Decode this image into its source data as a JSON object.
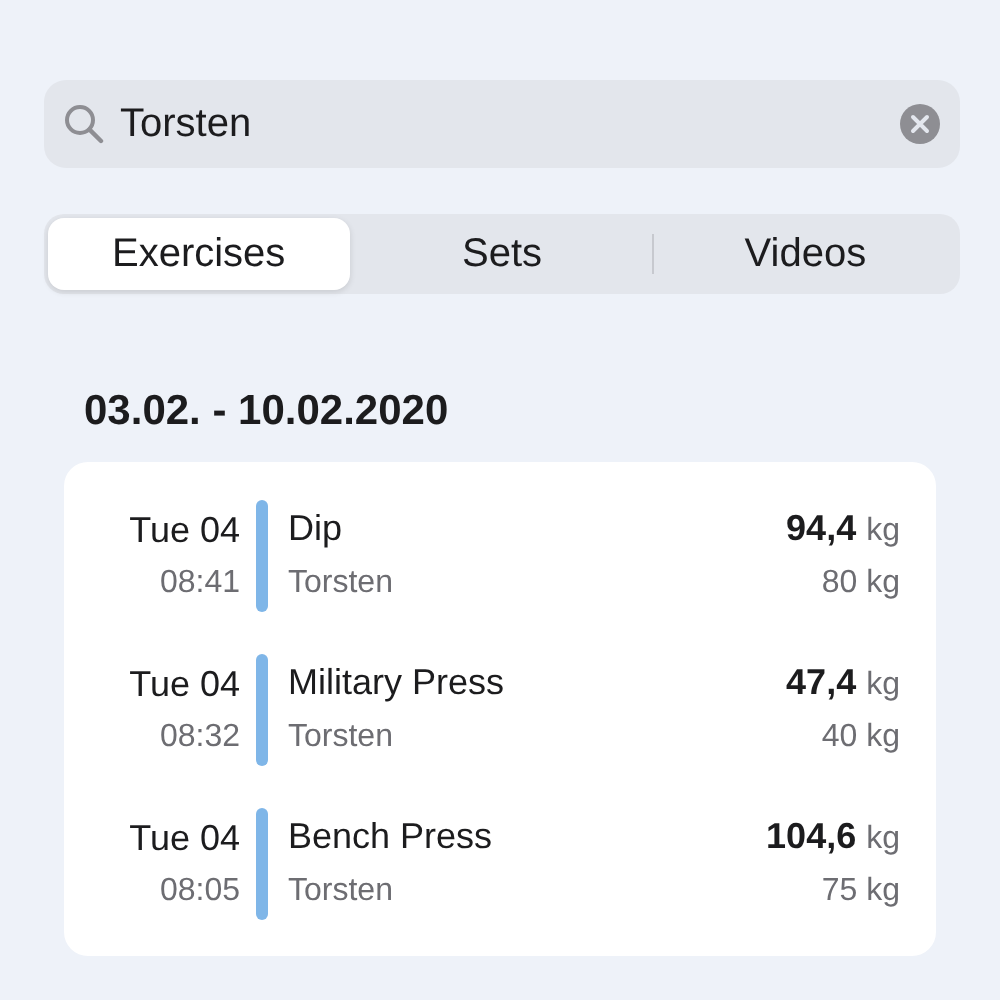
{
  "search": {
    "value": "Torsten"
  },
  "tabs": [
    {
      "label": "Exercises",
      "selected": true
    },
    {
      "label": "Sets",
      "selected": false
    },
    {
      "label": "Videos",
      "selected": false
    }
  ],
  "section_title": "03.02. - 10.02.2020",
  "entries": [
    {
      "day": "Tue 04",
      "time": "08:41",
      "exercise": "Dip",
      "person": "Torsten",
      "value": "94,4",
      "unit": "kg",
      "sub_value": "80 kg"
    },
    {
      "day": "Tue 04",
      "time": "08:32",
      "exercise": "Military Press",
      "person": "Torsten",
      "value": "47,4",
      "unit": "kg",
      "sub_value": "40 kg"
    },
    {
      "day": "Tue 04",
      "time": "08:05",
      "exercise": "Bench Press",
      "person": "Torsten",
      "value": "104,6",
      "unit": "kg",
      "sub_value": "75 kg"
    }
  ]
}
